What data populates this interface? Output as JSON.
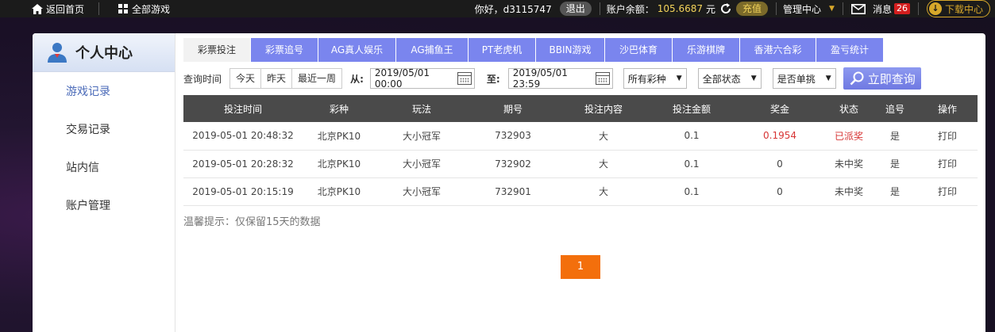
{
  "topbar": {
    "home": "返回首页",
    "all_games": "全部游戏",
    "greeting": "你好，d3115747",
    "logout": "退出",
    "balance_label": "账户余额：",
    "balance_value": "105.6687",
    "currency": "元",
    "recharge": "充值",
    "manage": "管理中心",
    "messages": "消息",
    "messages_count": "26",
    "download": "下载中心"
  },
  "sidebar": {
    "title": "个人中心",
    "items": [
      {
        "label": "游戏记录"
      },
      {
        "label": "交易记录"
      },
      {
        "label": "站内信"
      },
      {
        "label": "账户管理"
      }
    ]
  },
  "tabs": [
    {
      "label": "彩票投注"
    },
    {
      "label": "彩票追号"
    },
    {
      "label": "AG真人娱乐"
    },
    {
      "label": "AG捕鱼王"
    },
    {
      "label": "PT老虎机"
    },
    {
      "label": "BBIN游戏"
    },
    {
      "label": "沙巴体育"
    },
    {
      "label": "乐游棋牌"
    },
    {
      "label": "香港六合彩"
    },
    {
      "label": "盈亏统计"
    }
  ],
  "filters": {
    "query_time": "查询时间",
    "quick": [
      "今天",
      "昨天",
      "最近一周"
    ],
    "from_label": "从:",
    "from_value": "2019/05/01 00:00",
    "to_label": "至:",
    "to_value": "2019/05/01 23:59",
    "lottery_select": "所有彩种",
    "status_select": "全部状态",
    "single_select": "是否单挑",
    "query_button": "立即查询"
  },
  "table": {
    "headers": [
      "投注时间",
      "彩种",
      "玩法",
      "期号",
      "投注内容",
      "投注金额",
      "奖金",
      "状态",
      "追号",
      "操作"
    ],
    "rows": [
      [
        "2019-05-01 20:48:32",
        "北京PK10",
        "大小冠军",
        "732903",
        "大",
        "0.1",
        "0.1954",
        "已派奖",
        "是",
        "打印"
      ],
      [
        "2019-05-01 20:28:32",
        "北京PK10",
        "大小冠军",
        "732902",
        "大",
        "0.1",
        "0",
        "未中奖",
        "是",
        "打印"
      ],
      [
        "2019-05-01 20:15:19",
        "北京PK10",
        "大小冠军",
        "732901",
        "大",
        "0.1",
        "0",
        "未中奖",
        "是",
        "打印"
      ]
    ]
  },
  "tip": "温馨提示：仅保留15天的数据",
  "pager": {
    "current": "1"
  },
  "colors": {
    "accent": "#7a85ee",
    "pager": "#f36f0c",
    "win": "#d73535",
    "gold": "#f3d35a"
  }
}
